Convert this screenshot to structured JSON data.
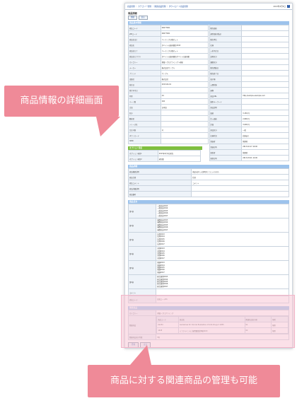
{
  "header": {
    "breadcrumb": "商品管理 ｜ カテゴリー管理 ｜ 関連商品管理 ｜ ダウンロード商品管理",
    "date": "2013年3月5日",
    "help": "?"
  },
  "page": {
    "title": "商品詳細",
    "buttons": [
      "登録",
      "戻る"
    ]
  },
  "basic": {
    "section_title": "商品基本情報",
    "left_rows": [
      {
        "k": "商品コード",
        "v": "00077001"
      },
      {
        "k": "JANコード",
        "v": "00077001"
      },
      {
        "k": "商品名(正)",
        "v": "ベーチングの歌セット"
      },
      {
        "k": "商品名",
        "v": "ダバイトの森雨量目2013"
      },
      {
        "k": "商品名カナ",
        "v": "ベーチングの歌セット"
      },
      {
        "k": "商品名カナ(下)",
        "v": "ダバイトの森雨量目ダバイトの森雨量"
      },
      {
        "k": "カテゴリー",
        "v": "書籍＞プログラミング＞初級"
      },
      {
        "k": "メーカー",
        "v": "株式会社サンプル"
      },
      {
        "k": "ブランド",
        "v": "サンプル"
      },
      {
        "k": "出版社",
        "v": "株式会社"
      },
      {
        "k": "発売日",
        "v": "2013-04-01"
      },
      {
        "k": "発行年月日",
        "v": ""
      },
      {
        "k": "判型",
        "v": "A5"
      },
      {
        "k": "ページ数",
        "v": "320"
      },
      {
        "k": "言語",
        "v": "日本語"
      },
      {
        "k": "区分",
        "v": ""
      },
      {
        "k": "翻訳者",
        "v": ""
      },
      {
        "k": "シリーズ名",
        "v": ""
      },
      {
        "k": "注文可能",
        "v": "可"
      },
      {
        "k": "ダウンロード",
        "v": ""
      },
      {
        "k": "ISBN",
        "v": ""
      }
    ],
    "right_rows": [
      {
        "k": "販売価格",
        "v": ""
      },
      {
        "k": "通常価格(税込)",
        "v": ""
      },
      {
        "k": "販売単位",
        "v": ""
      },
      {
        "k": "在庫",
        "v": ""
      },
      {
        "k": "入荷予定日",
        "v": ""
      },
      {
        "k": "送料区分",
        "v": ""
      },
      {
        "k": "課税区分",
        "v": ""
      },
      {
        "k": "販売開始日",
        "v": ""
      },
      {
        "k": "販売終了日",
        "v": ""
      },
      {
        "k": "表示順",
        "v": ""
      },
      {
        "k": "公開状態",
        "v": ""
      },
      {
        "k": "画像",
        "v": ""
      },
      {
        "k": "商品URL",
        "v": "http://sample.example.com"
      },
      {
        "k": "検索キーワード",
        "v": ""
      },
      {
        "k": "商品説明",
        "v": ""
      },
      {
        "k": "価格",
        "v": "3,150 円"
      },
      {
        "k": "仕入価格",
        "v": "2,800 円"
      },
      {
        "k": "定価",
        "v": "3,000 円"
      },
      {
        "k": "商品区分",
        "v": "一般"
      },
      {
        "k": "在庫状況",
        "v": "在庫あり"
      },
      {
        "k": "登録者",
        "v": "管理者"
      },
      {
        "k": "登録日時",
        "v": "2013-02-27 10:00"
      },
      {
        "k": "更新者",
        "v": "管理者"
      },
      {
        "k": "更新日時",
        "v": "2013-03-01 12:00"
      }
    ],
    "option_title": "オプション項目",
    "option_rows": [
      {
        "k": "オプション項目1",
        "v": "2013年4月1日発売"
      },
      {
        "k": "オプション項目2",
        "v": "初回版"
      }
    ]
  },
  "detail": {
    "section_title": "商品詳細",
    "rows": [
      {
        "k": "商品概要説明",
        "v": "商品の詳しい説明がここに入ります。"
      },
      {
        "k": "商品仕様",
        "v": "仕様"
      },
      {
        "k": "商品コメント",
        "v": "コメント"
      },
      {
        "k": "商品詳細説明",
        "v": ""
      },
      {
        "k": "商品備考",
        "v": ""
      }
    ]
  },
  "content": {
    "section_title": "商品目次",
    "rows": [
      {
        "k": "第1章",
        "lines": [
          "一般内容2013",
          "一般内容2014",
          "一般内容2015",
          "一般内容2016",
          "一般内容2017"
        ]
      },
      {
        "k": "第2章",
        "lines": [
          "基礎内容2013",
          "基礎内容2014",
          "基礎内容2015",
          "基礎内容2016",
          "基礎内容2017"
        ]
      },
      {
        "k": "第3章",
        "lines": [
          "応用2013",
          "応用2014",
          "応用2015",
          "応用2016",
          "応用2017"
        ]
      },
      {
        "k": "第4章",
        "lines": [
          "実践2013",
          "実践2014",
          "実践2015",
          "実践2016",
          "実践2017"
        ]
      },
      {
        "k": "第5章",
        "lines": [
          "発展2013",
          "発展2014",
          "発展2015",
          "発展2016",
          "発展2017"
        ]
      },
      {
        "k": "第6章",
        "lines": [
          "総合演習2013",
          "総合演習2014",
          "総合演習2015",
          "総合演習2016",
          "総合演習2017"
        ]
      },
      {
        "k": "コメント",
        "lines": [
          ""
        ]
      },
      {
        "k": "追加コード",
        "lines": [
          "追加コード01"
        ]
      }
    ]
  },
  "related": {
    "section_title": "関連商品",
    "category_label": "カテゴリー",
    "category_value": "書籍＞プログラミング",
    "header": [
      "商品コード",
      "商品名",
      "関連商品表示順",
      "削除"
    ],
    "row_label": "関連商品",
    "rows": [
      [
        "01234",
        "Guidelines for Clinical Evaluation of Anti-Drugs 2 1955",
        "01",
        "削除"
      ],
      [
        "1445",
        "ミラクルペンの上級問題集第8刷2013",
        "02",
        "削除"
      ]
    ],
    "extra_label": "関連商品表示件数",
    "extra_value": "5件"
  },
  "footer_buttons": [
    "登録",
    "戻る"
  ],
  "callouts": {
    "first": "商品情報の詳細画面",
    "second": "商品に対する関連商品の管理も可能"
  },
  "colors": {
    "section_bar": "#9dc3ec",
    "callout": "#ef8a98",
    "highlight": "#f8c6d6",
    "option_bar": "#7fbf3f"
  }
}
